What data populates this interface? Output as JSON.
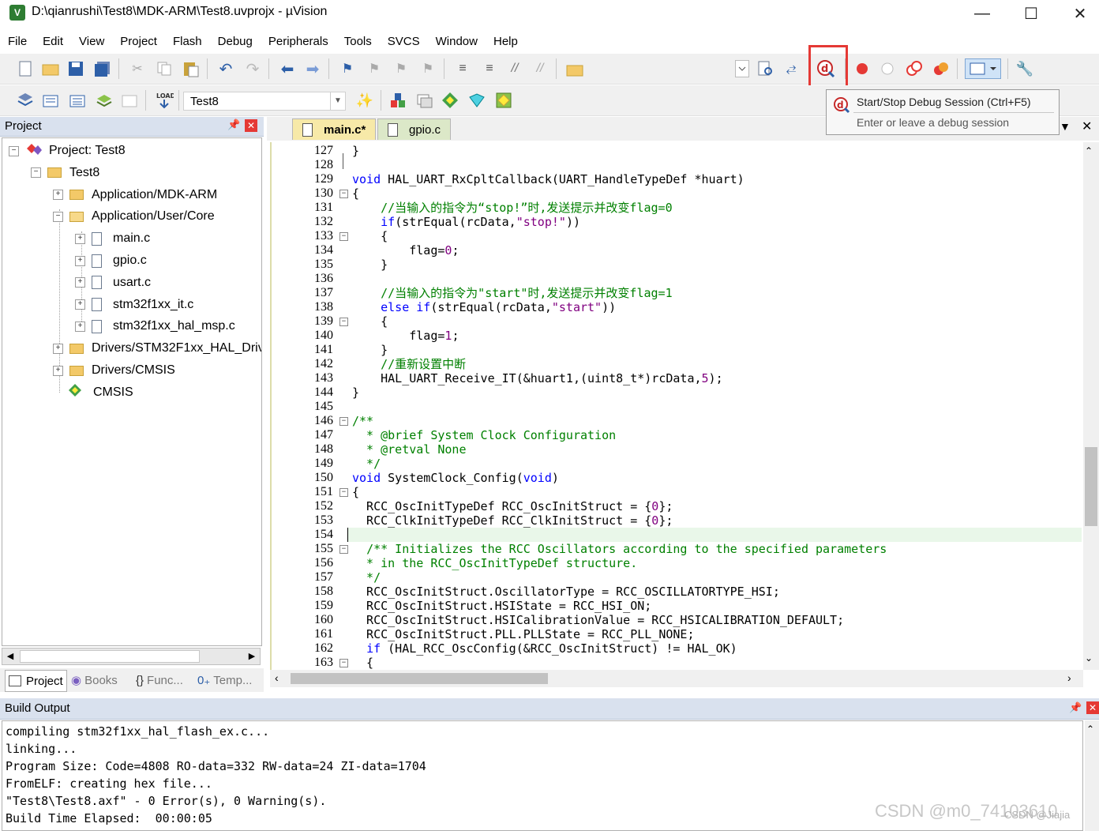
{
  "window": {
    "title": "D:\\qianrushi\\Test8\\MDK-ARM\\Test8.uvprojx - µVision",
    "app_icon": "uvision-icon",
    "controls": [
      "minimize",
      "maximize",
      "close"
    ]
  },
  "menubar": {
    "items": [
      "File",
      "Edit",
      "View",
      "Project",
      "Flash",
      "Debug",
      "Peripherals",
      "Tools",
      "SVCS",
      "Window",
      "Help"
    ]
  },
  "toolbar2": {
    "target_name": "Test8"
  },
  "tooltip": {
    "title": "Start/Stop Debug Session (Ctrl+F5)",
    "description": "Enter or leave a debug session"
  },
  "project_panel": {
    "title": "Project",
    "tree": [
      {
        "label": "Project: Test8",
        "level": 0,
        "expander": "−",
        "icon": "project-icon"
      },
      {
        "label": "Test8",
        "level": 1,
        "expander": "−",
        "icon": "target-folder-icon"
      },
      {
        "label": "Application/MDK-ARM",
        "level": 2,
        "expander": "+",
        "icon": "folder-icon"
      },
      {
        "label": "Application/User/Core",
        "level": 2,
        "expander": "−",
        "icon": "folder-open-icon"
      },
      {
        "label": "main.c",
        "level": 3,
        "expander": "+",
        "icon": "file-icon"
      },
      {
        "label": "gpio.c",
        "level": 3,
        "expander": "+",
        "icon": "file-icon"
      },
      {
        "label": "usart.c",
        "level": 3,
        "expander": "+",
        "icon": "file-icon"
      },
      {
        "label": "stm32f1xx_it.c",
        "level": 3,
        "expander": "+",
        "icon": "file-icon"
      },
      {
        "label": "stm32f1xx_hal_msp.c",
        "level": 3,
        "expander": "+",
        "icon": "file-icon"
      },
      {
        "label": "Drivers/STM32F1xx_HAL_Driv",
        "level": 2,
        "expander": "+",
        "icon": "folder-icon"
      },
      {
        "label": "Drivers/CMSIS",
        "level": 2,
        "expander": "+",
        "icon": "folder-icon"
      },
      {
        "label": "CMSIS",
        "level": 2,
        "expander": "",
        "icon": "cmsis-diamond-icon"
      }
    ],
    "tabs": [
      "Project",
      "Books",
      "Func...",
      "Temp..."
    ]
  },
  "editor": {
    "tabs": [
      {
        "label": "main.c*",
        "active": true
      },
      {
        "label": "gpio.c",
        "active": false
      }
    ],
    "lines": [
      {
        "n": "127",
        "fold": "",
        "segs": [
          [
            "",
            "}"
          ]
        ]
      },
      {
        "n": "128",
        "fold": "",
        "segs": [
          [
            "",
            ""
          ]
        ]
      },
      {
        "n": "129",
        "fold": "",
        "segs": [
          [
            "kw",
            "void"
          ],
          [
            "",
            " HAL_UART_RxCpltCallback(UART_HandleTypeDef *huart)"
          ]
        ]
      },
      {
        "n": "130",
        "fold": "−",
        "segs": [
          [
            "",
            "{"
          ]
        ]
      },
      {
        "n": "131",
        "fold": "",
        "segs": [
          [
            "",
            "    "
          ],
          [
            "cm",
            "//当输入的指令为“stop!”时,发送提示并改变flag=0"
          ]
        ]
      },
      {
        "n": "132",
        "fold": "",
        "segs": [
          [
            "",
            "    "
          ],
          [
            "kw",
            "if"
          ],
          [
            "",
            "(strEqual(rcData,"
          ],
          [
            "st",
            "\"stop!\""
          ],
          [
            "",
            "))"
          ]
        ]
      },
      {
        "n": "133",
        "fold": "−",
        "segs": [
          [
            "",
            "    {"
          ]
        ]
      },
      {
        "n": "134",
        "fold": "",
        "segs": [
          [
            "",
            "        flag="
          ],
          [
            "nm",
            "0"
          ],
          [
            "",
            ";"
          ]
        ]
      },
      {
        "n": "135",
        "fold": "",
        "segs": [
          [
            "",
            "    }"
          ]
        ]
      },
      {
        "n": "136",
        "fold": "",
        "segs": [
          [
            "",
            ""
          ]
        ]
      },
      {
        "n": "137",
        "fold": "",
        "segs": [
          [
            "",
            "    "
          ],
          [
            "cm",
            "//当输入的指令为\"start\"时,发送提示并改变flag=1"
          ]
        ]
      },
      {
        "n": "138",
        "fold": "",
        "segs": [
          [
            "",
            "    "
          ],
          [
            "kw",
            "else if"
          ],
          [
            "",
            "(strEqual(rcData,"
          ],
          [
            "st",
            "\"start\""
          ],
          [
            "",
            "))"
          ]
        ]
      },
      {
        "n": "139",
        "fold": "−",
        "segs": [
          [
            "",
            "    {"
          ]
        ]
      },
      {
        "n": "140",
        "fold": "",
        "segs": [
          [
            "",
            "        flag="
          ],
          [
            "nm",
            "1"
          ],
          [
            "",
            ";"
          ]
        ]
      },
      {
        "n": "141",
        "fold": "",
        "segs": [
          [
            "",
            "    }"
          ]
        ]
      },
      {
        "n": "142",
        "fold": "",
        "segs": [
          [
            "",
            "    "
          ],
          [
            "cm",
            "//重新设置中断"
          ]
        ]
      },
      {
        "n": "143",
        "fold": "",
        "segs": [
          [
            "",
            "    HAL_UART_Receive_IT(&huart1,(uint8_t*)rcData,"
          ],
          [
            "nm",
            "5"
          ],
          [
            "",
            ");"
          ]
        ]
      },
      {
        "n": "144",
        "fold": "",
        "segs": [
          [
            "",
            "}"
          ]
        ]
      },
      {
        "n": "145",
        "fold": "",
        "segs": [
          [
            "",
            ""
          ]
        ]
      },
      {
        "n": "146",
        "fold": "−",
        "segs": [
          [
            "cm",
            "/**"
          ]
        ]
      },
      {
        "n": "147",
        "fold": "",
        "segs": [
          [
            "cm",
            "  * @brief System Clock Configuration"
          ]
        ]
      },
      {
        "n": "148",
        "fold": "",
        "segs": [
          [
            "cm",
            "  * @retval None"
          ]
        ]
      },
      {
        "n": "149",
        "fold": "",
        "segs": [
          [
            "cm",
            "  */"
          ]
        ]
      },
      {
        "n": "150",
        "fold": "",
        "segs": [
          [
            "kw",
            "void"
          ],
          [
            "",
            " SystemClock_Config("
          ],
          [
            "kw",
            "void"
          ],
          [
            "",
            ")"
          ]
        ]
      },
      {
        "n": "151",
        "fold": "−",
        "segs": [
          [
            "",
            "{"
          ]
        ]
      },
      {
        "n": "152",
        "fold": "",
        "segs": [
          [
            "",
            "  RCC_OscInitTypeDef RCC_OscInitStruct = {"
          ],
          [
            "nm",
            "0"
          ],
          [
            "",
            "};"
          ]
        ]
      },
      {
        "n": "153",
        "fold": "",
        "segs": [
          [
            "",
            "  RCC_ClkInitTypeDef RCC_ClkInitStruct = {"
          ],
          [
            "nm",
            "0"
          ],
          [
            "",
            "};"
          ]
        ]
      },
      {
        "n": "154",
        "fold": "",
        "segs": [
          [
            "",
            ""
          ]
        ]
      },
      {
        "n": "155",
        "fold": "−",
        "segs": [
          [
            "",
            "  "
          ],
          [
            "cm",
            "/** Initializes the RCC Oscillators according to the specified parameters"
          ]
        ]
      },
      {
        "n": "156",
        "fold": "",
        "segs": [
          [
            "cm",
            "  * in the RCC_OscInitTypeDef structure."
          ]
        ]
      },
      {
        "n": "157",
        "fold": "",
        "segs": [
          [
            "cm",
            "  */"
          ]
        ]
      },
      {
        "n": "158",
        "fold": "",
        "segs": [
          [
            "",
            "  RCC_OscInitStruct.OscillatorType = RCC_OSCILLATORTYPE_HSI;"
          ]
        ]
      },
      {
        "n": "159",
        "fold": "",
        "segs": [
          [
            "",
            "  RCC_OscInitStruct.HSIState = RCC_HSI_ON;"
          ]
        ]
      },
      {
        "n": "160",
        "fold": "",
        "segs": [
          [
            "",
            "  RCC_OscInitStruct.HSICalibrationValue = RCC_HSICALIBRATION_DEFAULT;"
          ]
        ]
      },
      {
        "n": "161",
        "fold": "",
        "segs": [
          [
            "",
            "  RCC_OscInitStruct.PLL.PLLState = RCC_PLL_NONE;"
          ]
        ]
      },
      {
        "n": "162",
        "fold": "",
        "segs": [
          [
            "",
            "  "
          ],
          [
            "kw",
            "if"
          ],
          [
            "",
            " (HAL_RCC_OscConfig(&RCC_OscInitStruct) != HAL_OK)"
          ]
        ]
      },
      {
        "n": "163",
        "fold": "−",
        "segs": [
          [
            "",
            "  {"
          ]
        ]
      }
    ]
  },
  "build_output": {
    "title": "Build Output",
    "lines": [
      "compiling stm32f1xx_hal_flash_ex.c...",
      "linking...",
      "Program Size: Code=4808 RO-data=332 RW-data=24 ZI-data=1704",
      "FromELF: creating hex file...",
      "\"Test8\\Test8.axf\" - 0 Error(s), 0 Warning(s).",
      "Build Time Elapsed:  00:00:05"
    ]
  },
  "watermark": {
    "text": "CSDN @m0_74103610",
    "overlay": "CSDN @Jiajia"
  },
  "colors": {
    "keyword": "#0000ff",
    "comment": "#008000",
    "string": "#800080",
    "highlight_box": "#e53935",
    "panel_header": "#d9e1ee"
  }
}
